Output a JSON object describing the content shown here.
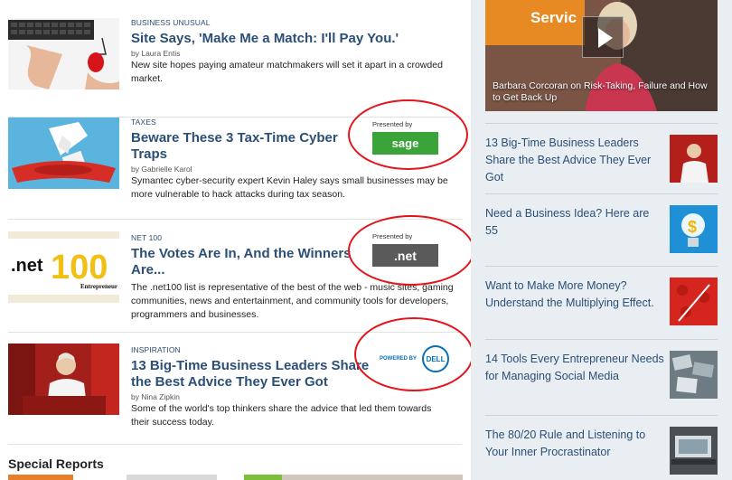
{
  "articles": [
    {
      "category": "Business Unusual",
      "headline": "Site Says, 'Make Me a Match: I'll Pay You.'",
      "byline": "by Laura Entis",
      "summary": "New site hopes paying amateur matchmakers will set it apart in a crowded market."
    },
    {
      "category": "Taxes",
      "headline": "Beware These 3 Tax-Time Cyber Traps",
      "byline": "by Gabrielle Karol",
      "summary": "Symantec cyber-security expert Kevin Haley says small businesses may be more vulnerable to hack attacks during tax season.",
      "sponsor_label": "Presented by",
      "sponsor_logo": "sage"
    },
    {
      "category": "Net 100",
      "headline": "The Votes Are In, And the Winners Are...",
      "byline": "",
      "summary": "The .net100 list is representative of the best of the web - music sites, gaming communities, news and entertainment, and community tools for developers, programmers and businesses.",
      "sponsor_label": "Presented by",
      "sponsor_logo": ".net",
      "thumb_logo_a": ".net",
      "thumb_logo_b": "100",
      "thumb_logo_c": "Entrepreneur"
    },
    {
      "category": "Inspiration",
      "headline": "13 Big-Time Business Leaders Share the Best Advice They Ever Got",
      "byline": "by Nina Zipkin",
      "summary": "Some of the world's top thinkers share the advice that led them towards their success today.",
      "sponsor_label": "POWERED BY",
      "sponsor_logo": "DELL"
    }
  ],
  "special_reports": {
    "title": "Special Reports"
  },
  "video": {
    "thumb_text": "Servic",
    "caption": "Barbara Corcoran on Risk-Taking, Failure and How to Get Back Up"
  },
  "sidebar": [
    {
      "text": "13 Big-Time Business Leaders Share the Best Advice They Ever Got"
    },
    {
      "text": "Need a Business Idea? Here are 55"
    },
    {
      "text": "Want to Make More Money? Understand the Multiplying Effect."
    },
    {
      "text": "14 Tools Every Entrepreneur Needs for Managing Social Media"
    },
    {
      "text": "The 80/20 Rule and Listening to Your Inner Procrastinator"
    }
  ],
  "colors": {
    "headline": "#2b4f76",
    "annotation_ring": "#e4141b",
    "sage_green": "#3aa33a",
    "dell_blue": "#0a6eb4",
    "sidebar_bg": "#e9eef3"
  }
}
